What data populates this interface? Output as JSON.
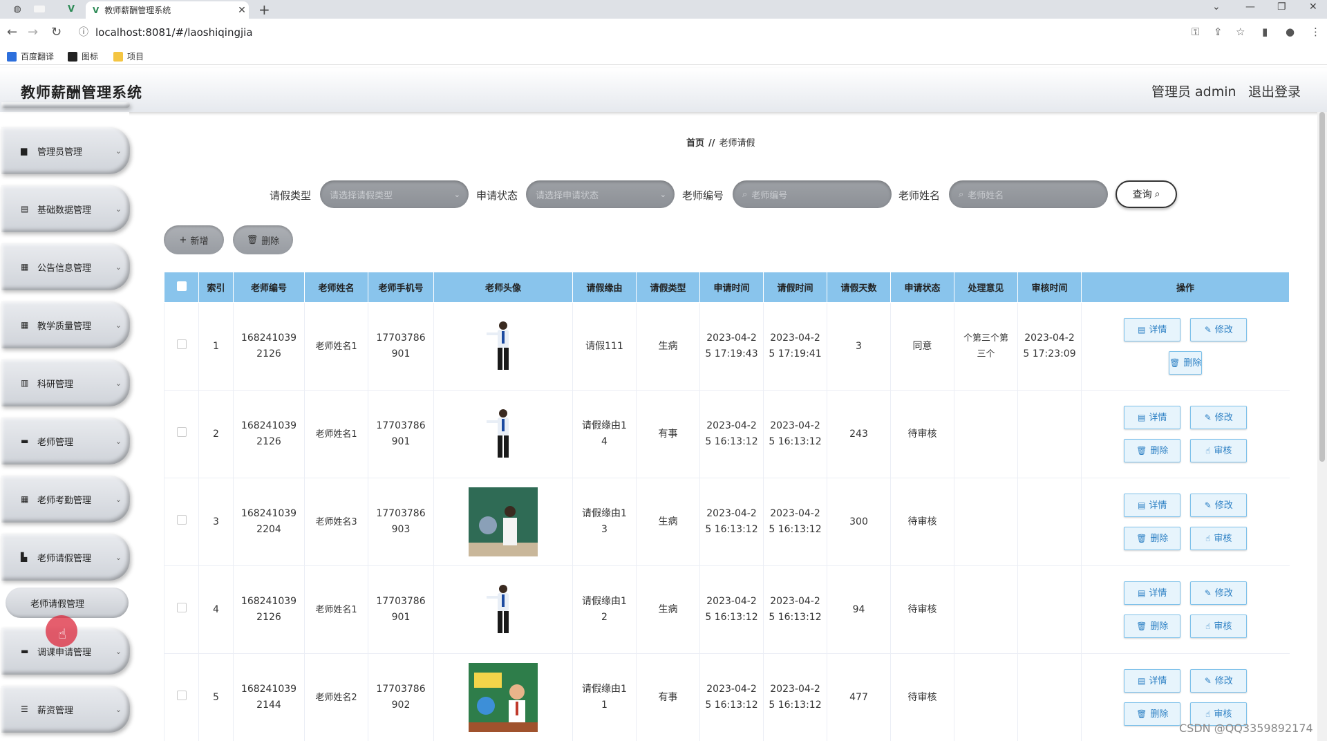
{
  "browser": {
    "tab_title": "教师薪酬管理系统",
    "url": "localhost:8081/#/laoshiqingjia",
    "bookmarks": [
      "百度翻译",
      "图标",
      "项目"
    ]
  },
  "header": {
    "title": "教师薪酬管理系统",
    "admin": "管理员 admin",
    "logout": "退出登录"
  },
  "sidebar": {
    "items": [
      {
        "label": "管理员管理",
        "icon": "lock-icon"
      },
      {
        "label": "基础数据管理",
        "icon": "list-icon"
      },
      {
        "label": "公告信息管理",
        "icon": "grid-icon"
      },
      {
        "label": "教学质量管理",
        "icon": "grid-icon"
      },
      {
        "label": "科研管理",
        "icon": "doc-icon"
      },
      {
        "label": "老师管理",
        "icon": "user-icon"
      },
      {
        "label": "老师考勤管理",
        "icon": "grid-icon"
      },
      {
        "label": "老师请假管理",
        "icon": "chart-icon"
      },
      {
        "label": "调课申请管理",
        "icon": "monitor-icon"
      },
      {
        "label": "薪资管理",
        "icon": "sliders-icon"
      }
    ],
    "active_sub": "老师请假管理"
  },
  "breadcrumb": {
    "home": "首页",
    "sep": "//",
    "current": "老师请假"
  },
  "filters": {
    "leave_type_label": "请假类型",
    "leave_type_placeholder": "请选择请假类型",
    "status_label": "申请状态",
    "status_placeholder": "请选择申请状态",
    "teacher_no_label": "老师编号",
    "teacher_no_placeholder": "老师编号",
    "teacher_name_label": "老师姓名",
    "teacher_name_placeholder": "老师姓名",
    "search": "查询"
  },
  "toolbar": {
    "add": "新增",
    "delete": "删除"
  },
  "table": {
    "columns": [
      "索引",
      "老师编号",
      "老师姓名",
      "老师手机号",
      "老师头像",
      "请假缘由",
      "请假类型",
      "申请时间",
      "请假时间",
      "请假天数",
      "申请状态",
      "处理意见",
      "审核时间",
      "操作"
    ],
    "rows": [
      {
        "index": "1",
        "no_a": "168241039",
        "no_b": "2126",
        "name": "老师姓名1",
        "phone_a": "17703786",
        "phone_b": "901",
        "reason_a": "请假111",
        "reason_b": "",
        "type": "生病",
        "apply_a": "2023-04-2",
        "apply_b": "5 17:19:43",
        "leave_a": "2023-04-2",
        "leave_b": "5 17:19:41",
        "days": "3",
        "status": "同意",
        "opinion_a": "个第三个第",
        "opinion_b": "三个",
        "audit_a": "2023-04-2",
        "audit_b": "5 17:23:09"
      },
      {
        "index": "2",
        "no_a": "168241039",
        "no_b": "2126",
        "name": "老师姓名1",
        "phone_a": "17703786",
        "phone_b": "901",
        "reason_a": "请假缘由1",
        "reason_b": "4",
        "type": "有事",
        "apply_a": "2023-04-2",
        "apply_b": "5 16:13:12",
        "leave_a": "2023-04-2",
        "leave_b": "5 16:13:12",
        "days": "243",
        "status": "待审核",
        "opinion_a": "",
        "opinion_b": "",
        "audit_a": "",
        "audit_b": ""
      },
      {
        "index": "3",
        "no_a": "168241039",
        "no_b": "2204",
        "name": "老师姓名3",
        "phone_a": "17703786",
        "phone_b": "903",
        "reason_a": "请假缘由1",
        "reason_b": "3",
        "type": "生病",
        "apply_a": "2023-04-2",
        "apply_b": "5 16:13:12",
        "leave_a": "2023-04-2",
        "leave_b": "5 16:13:12",
        "days": "300",
        "status": "待审核",
        "opinion_a": "",
        "opinion_b": "",
        "audit_a": "",
        "audit_b": ""
      },
      {
        "index": "4",
        "no_a": "168241039",
        "no_b": "2126",
        "name": "老师姓名1",
        "phone_a": "17703786",
        "phone_b": "901",
        "reason_a": "请假缘由1",
        "reason_b": "2",
        "type": "生病",
        "apply_a": "2023-04-2",
        "apply_b": "5 16:13:12",
        "leave_a": "2023-04-2",
        "leave_b": "5 16:13:12",
        "days": "94",
        "status": "待审核",
        "opinion_a": "",
        "opinion_b": "",
        "audit_a": "",
        "audit_b": ""
      },
      {
        "index": "5",
        "no_a": "168241039",
        "no_b": "2144",
        "name": "老师姓名2",
        "phone_a": "17703786",
        "phone_b": "902",
        "reason_a": "请假缘由1",
        "reason_b": "1",
        "type": "有事",
        "apply_a": "2023-04-2",
        "apply_b": "5 16:13:12",
        "leave_a": "2023-04-2",
        "leave_b": "5 16:13:12",
        "days": "477",
        "status": "待审核",
        "opinion_a": "",
        "opinion_b": "",
        "audit_a": "",
        "audit_b": ""
      }
    ],
    "ops": {
      "detail": "详情",
      "edit": "修改",
      "delete": "删除",
      "audit": "审核"
    }
  },
  "watermark": "CSDN @QQ3359892174"
}
